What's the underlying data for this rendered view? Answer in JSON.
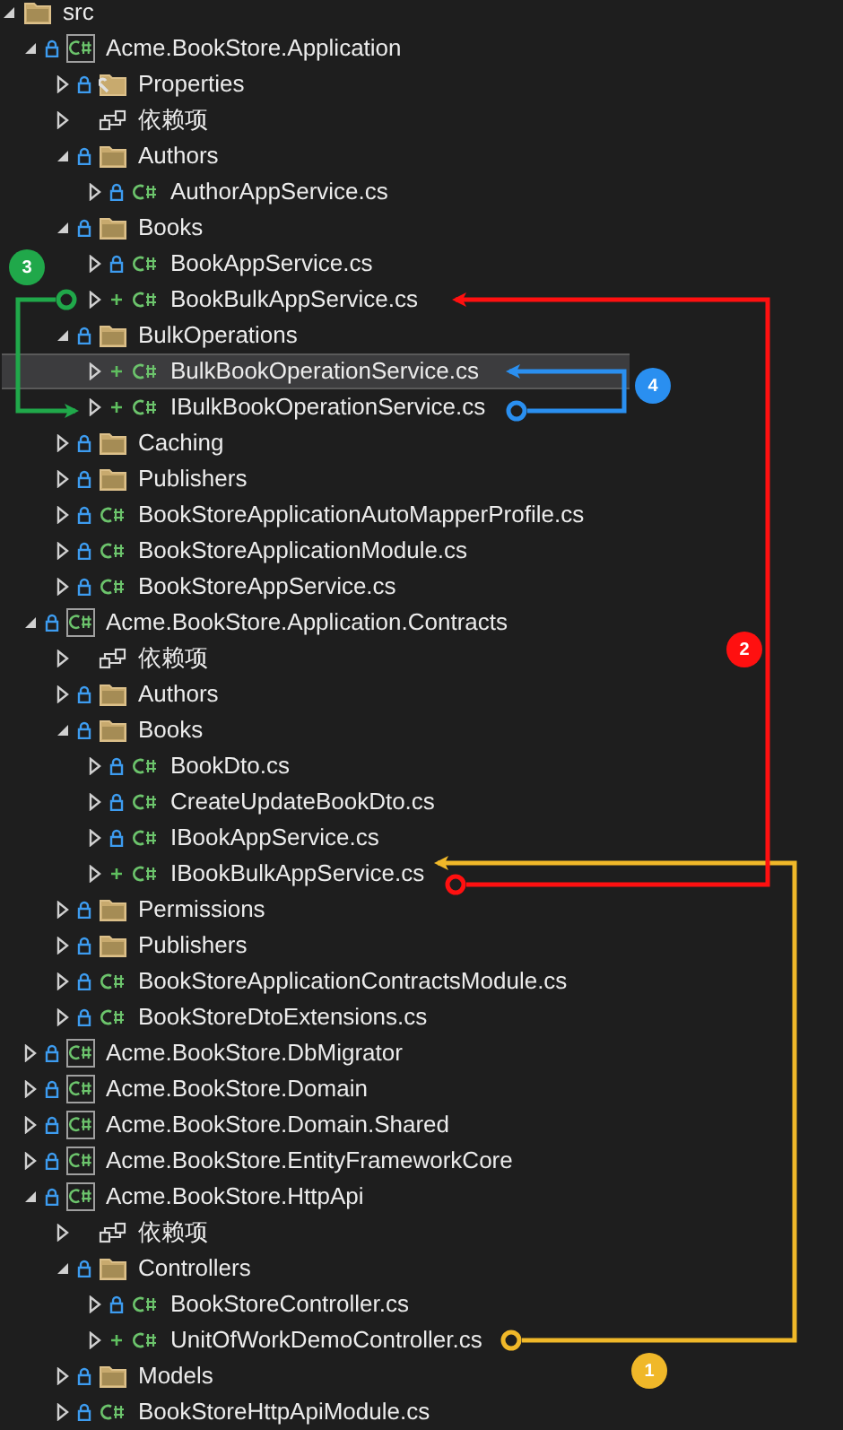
{
  "tree": [
    {
      "label": "src",
      "kind": "folder",
      "locked": false,
      "added": false,
      "expanded": true,
      "selected": false,
      "children": [
        {
          "label": "Acme.BookStore.Application",
          "kind": "project",
          "locked": true,
          "added": false,
          "expanded": true,
          "selected": false,
          "children": [
            {
              "label": "Properties",
              "kind": "properties",
              "locked": true,
              "added": false,
              "expanded": false,
              "selected": false
            },
            {
              "label": "依赖项",
              "kind": "dependencies",
              "locked": false,
              "added": false,
              "expanded": false,
              "selected": false
            },
            {
              "label": "Authors",
              "kind": "folder",
              "locked": true,
              "added": false,
              "expanded": true,
              "selected": false,
              "children": [
                {
                  "label": "AuthorAppService.cs",
                  "kind": "file",
                  "locked": true,
                  "added": false,
                  "expanded": false,
                  "selected": false
                }
              ]
            },
            {
              "label": "Books",
              "kind": "folder",
              "locked": true,
              "added": false,
              "expanded": true,
              "selected": false,
              "children": [
                {
                  "label": "BookAppService.cs",
                  "kind": "file",
                  "locked": true,
                  "added": false,
                  "expanded": false,
                  "selected": false
                },
                {
                  "label": "BookBulkAppService.cs",
                  "kind": "file",
                  "locked": false,
                  "added": true,
                  "expanded": false,
                  "selected": false
                }
              ]
            },
            {
              "label": "BulkOperations",
              "kind": "folder",
              "locked": true,
              "added": false,
              "expanded": true,
              "selected": false,
              "children": [
                {
                  "label": "BulkBookOperationService.cs",
                  "kind": "file",
                  "locked": false,
                  "added": true,
                  "expanded": false,
                  "selected": true
                },
                {
                  "label": "IBulkBookOperationService.cs",
                  "kind": "file",
                  "locked": false,
                  "added": true,
                  "expanded": false,
                  "selected": false
                }
              ]
            },
            {
              "label": "Caching",
              "kind": "folder",
              "locked": true,
              "added": false,
              "expanded": false,
              "selected": false
            },
            {
              "label": "Publishers",
              "kind": "folder",
              "locked": true,
              "added": false,
              "expanded": false,
              "selected": false
            },
            {
              "label": "BookStoreApplicationAutoMapperProfile.cs",
              "kind": "file",
              "locked": true,
              "added": false,
              "expanded": false,
              "selected": false
            },
            {
              "label": "BookStoreApplicationModule.cs",
              "kind": "file",
              "locked": true,
              "added": false,
              "expanded": false,
              "selected": false
            },
            {
              "label": "BookStoreAppService.cs",
              "kind": "file",
              "locked": true,
              "added": false,
              "expanded": false,
              "selected": false
            }
          ]
        },
        {
          "label": "Acme.BookStore.Application.Contracts",
          "kind": "project",
          "locked": true,
          "added": false,
          "expanded": true,
          "selected": false,
          "children": [
            {
              "label": "依赖项",
              "kind": "dependencies",
              "locked": false,
              "added": false,
              "expanded": false,
              "selected": false
            },
            {
              "label": "Authors",
              "kind": "folder",
              "locked": true,
              "added": false,
              "expanded": false,
              "selected": false
            },
            {
              "label": "Books",
              "kind": "folder",
              "locked": true,
              "added": false,
              "expanded": true,
              "selected": false,
              "children": [
                {
                  "label": "BookDto.cs",
                  "kind": "file",
                  "locked": true,
                  "added": false,
                  "expanded": false,
                  "selected": false
                },
                {
                  "label": "CreateUpdateBookDto.cs",
                  "kind": "file",
                  "locked": true,
                  "added": false,
                  "expanded": false,
                  "selected": false
                },
                {
                  "label": "IBookAppService.cs",
                  "kind": "file",
                  "locked": true,
                  "added": false,
                  "expanded": false,
                  "selected": false
                },
                {
                  "label": "IBookBulkAppService.cs",
                  "kind": "file",
                  "locked": false,
                  "added": true,
                  "expanded": false,
                  "selected": false
                }
              ]
            },
            {
              "label": "Permissions",
              "kind": "folder",
              "locked": true,
              "added": false,
              "expanded": false,
              "selected": false
            },
            {
              "label": "Publishers",
              "kind": "folder",
              "locked": true,
              "added": false,
              "expanded": false,
              "selected": false
            },
            {
              "label": "BookStoreApplicationContractsModule.cs",
              "kind": "file",
              "locked": true,
              "added": false,
              "expanded": false,
              "selected": false
            },
            {
              "label": "BookStoreDtoExtensions.cs",
              "kind": "file",
              "locked": true,
              "added": false,
              "expanded": false,
              "selected": false
            }
          ]
        },
        {
          "label": "Acme.BookStore.DbMigrator",
          "kind": "project",
          "locked": true,
          "added": false,
          "expanded": false,
          "selected": false
        },
        {
          "label": "Acme.BookStore.Domain",
          "kind": "project",
          "locked": true,
          "added": false,
          "expanded": false,
          "selected": false
        },
        {
          "label": "Acme.BookStore.Domain.Shared",
          "kind": "project",
          "locked": true,
          "added": false,
          "expanded": false,
          "selected": false
        },
        {
          "label": "Acme.BookStore.EntityFrameworkCore",
          "kind": "project",
          "locked": true,
          "added": false,
          "expanded": false,
          "selected": false
        },
        {
          "label": "Acme.BookStore.HttpApi",
          "kind": "project",
          "locked": true,
          "added": false,
          "expanded": true,
          "selected": false,
          "children": [
            {
              "label": "依赖项",
              "kind": "dependencies",
              "locked": false,
              "added": false,
              "expanded": false,
              "selected": false
            },
            {
              "label": "Controllers",
              "kind": "folder",
              "locked": true,
              "added": false,
              "expanded": true,
              "selected": false,
              "children": [
                {
                  "label": "BookStoreController.cs",
                  "kind": "file",
                  "locked": true,
                  "added": false,
                  "expanded": false,
                  "selected": false
                },
                {
                  "label": "UnitOfWorkDemoController.cs",
                  "kind": "file",
                  "locked": false,
                  "added": true,
                  "expanded": false,
                  "selected": false
                }
              ]
            },
            {
              "label": "Models",
              "kind": "folder",
              "locked": true,
              "added": false,
              "expanded": false,
              "selected": false
            },
            {
              "label": "BookStoreHttpApiModule.cs",
              "kind": "file",
              "locked": true,
              "added": false,
              "expanded": false,
              "selected": false
            }
          ]
        }
      ]
    }
  ],
  "annotations": [
    {
      "number": "1",
      "color": "#f0b829"
    },
    {
      "number": "2",
      "color": "#ff1010"
    },
    {
      "number": "3",
      "color": "#20a84a"
    },
    {
      "number": "4",
      "color": "#2a8ff0"
    }
  ]
}
